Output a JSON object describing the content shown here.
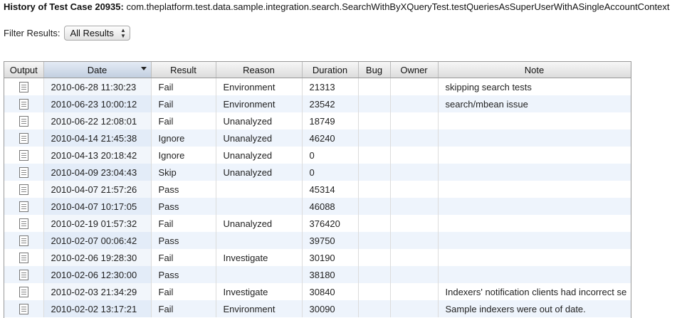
{
  "header": {
    "title_prefix": "History of Test Case 20935:",
    "title_test": "com.theplatform.test.data.sample.integration.search.SearchWithByXQueryTest.testQueriesAsSuperUserWithASingleAccountContext"
  },
  "filter": {
    "label": "Filter Results:",
    "selected": "All Results"
  },
  "table": {
    "columns": {
      "output": "Output",
      "date": "Date",
      "result": "Result",
      "reason": "Reason",
      "duration": "Duration",
      "bug": "Bug",
      "owner": "Owner",
      "note": "Note"
    },
    "sorted_column": "Date",
    "rows": [
      {
        "date": "2010-06-28 11:30:23",
        "result": "Fail",
        "reason": "Environment",
        "duration": "21313",
        "bug": "",
        "owner": "",
        "note": "skipping search tests"
      },
      {
        "date": "2010-06-23 10:00:12",
        "result": "Fail",
        "reason": "Environment",
        "duration": "23542",
        "bug": "",
        "owner": "",
        "note": "search/mbean issue"
      },
      {
        "date": "2010-06-22 12:08:01",
        "result": "Fail",
        "reason": "Unanalyzed",
        "duration": "18749",
        "bug": "",
        "owner": "",
        "note": ""
      },
      {
        "date": "2010-04-14 21:45:38",
        "result": "Ignore",
        "reason": "Unanalyzed",
        "duration": "46240",
        "bug": "",
        "owner": "",
        "note": ""
      },
      {
        "date": "2010-04-13 20:18:42",
        "result": "Ignore",
        "reason": "Unanalyzed",
        "duration": "0",
        "bug": "",
        "owner": "",
        "note": ""
      },
      {
        "date": "2010-04-09 23:04:43",
        "result": "Skip",
        "reason": "Unanalyzed",
        "duration": "0",
        "bug": "",
        "owner": "",
        "note": ""
      },
      {
        "date": "2010-04-07 21:57:26",
        "result": "Pass",
        "reason": "",
        "duration": "45314",
        "bug": "",
        "owner": "",
        "note": ""
      },
      {
        "date": "2010-04-07 10:17:05",
        "result": "Pass",
        "reason": "",
        "duration": "46088",
        "bug": "",
        "owner": "",
        "note": ""
      },
      {
        "date": "2010-02-19 01:57:32",
        "result": "Fail",
        "reason": "Unanalyzed",
        "duration": "376420",
        "bug": "",
        "owner": "",
        "note": ""
      },
      {
        "date": "2010-02-07 00:06:42",
        "result": "Pass",
        "reason": "",
        "duration": "39750",
        "bug": "",
        "owner": "",
        "note": ""
      },
      {
        "date": "2010-02-06 19:28:30",
        "result": "Fail",
        "reason": "Investigate",
        "duration": "30190",
        "bug": "",
        "owner": "",
        "note": ""
      },
      {
        "date": "2010-02-06 12:30:00",
        "result": "Pass",
        "reason": "",
        "duration": "38180",
        "bug": "",
        "owner": "",
        "note": ""
      },
      {
        "date": "2010-02-03 21:34:29",
        "result": "Fail",
        "reason": "Investigate",
        "duration": "30840",
        "bug": "",
        "owner": "",
        "note": "Indexers' notification clients had incorrect se"
      },
      {
        "date": "2010-02-02 13:17:21",
        "result": "Fail",
        "reason": "Environment",
        "duration": "30090",
        "bug": "",
        "owner": "",
        "note": "Sample indexers were out of date."
      }
    ]
  }
}
